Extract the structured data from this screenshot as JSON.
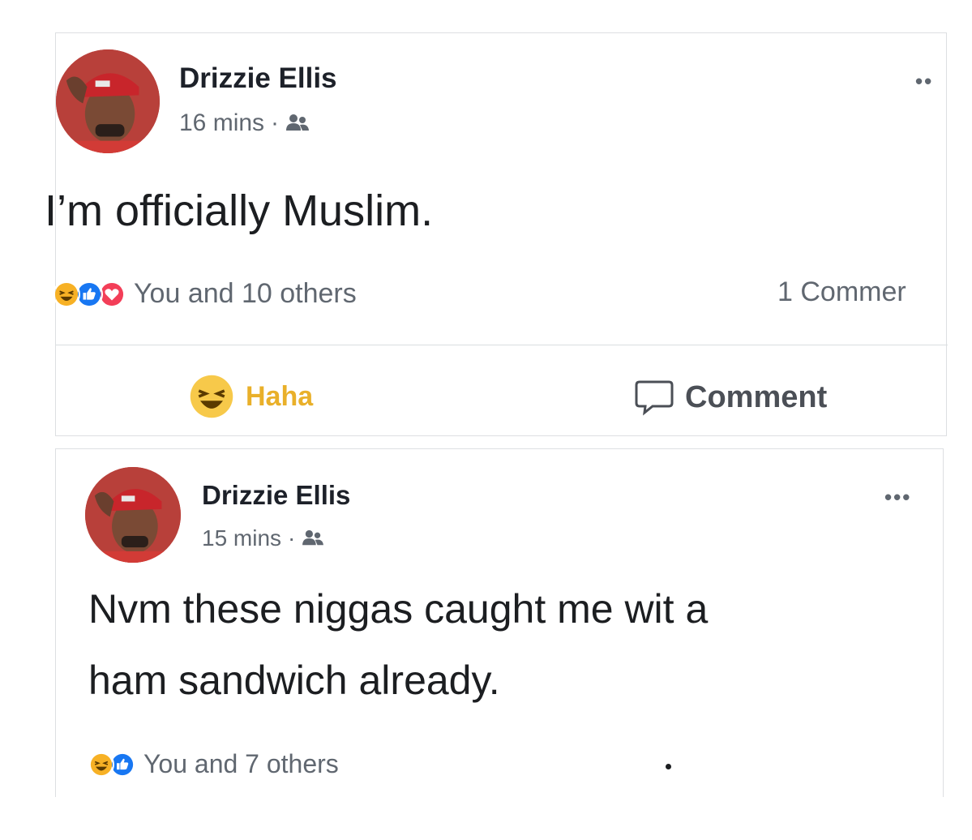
{
  "posts": [
    {
      "author": "Drizzie Ellis",
      "time": "16 mins",
      "separator": "·",
      "text": "I’m officially Muslim.",
      "reaction_summary": "You and 10 others",
      "comments_count": "1 Commer",
      "more_menu": "••",
      "actions": {
        "haha_label": "Haha",
        "comment_label": "Comment"
      },
      "reactions": [
        "haha",
        "like",
        "love"
      ]
    },
    {
      "author": "Drizzie Ellis",
      "time": "15 mins",
      "separator": "·",
      "text_line1": "Nvm these niggas caught me wit a",
      "text_line2": "ham sandwich already.",
      "reaction_summary": "You and 7 others",
      "more_menu": "•••",
      "reactions": [
        "haha",
        "like"
      ]
    }
  ],
  "icons": {
    "audience": "friends-icon",
    "haha": "haha-reaction-icon",
    "like": "like-reaction-icon",
    "love": "love-reaction-icon",
    "comment": "comment-bubble-icon"
  },
  "colors": {
    "like_blue": "#1877f2",
    "love_red": "#f33e58",
    "haha_yellow": "#f7b125",
    "meta_grey": "#606770"
  }
}
